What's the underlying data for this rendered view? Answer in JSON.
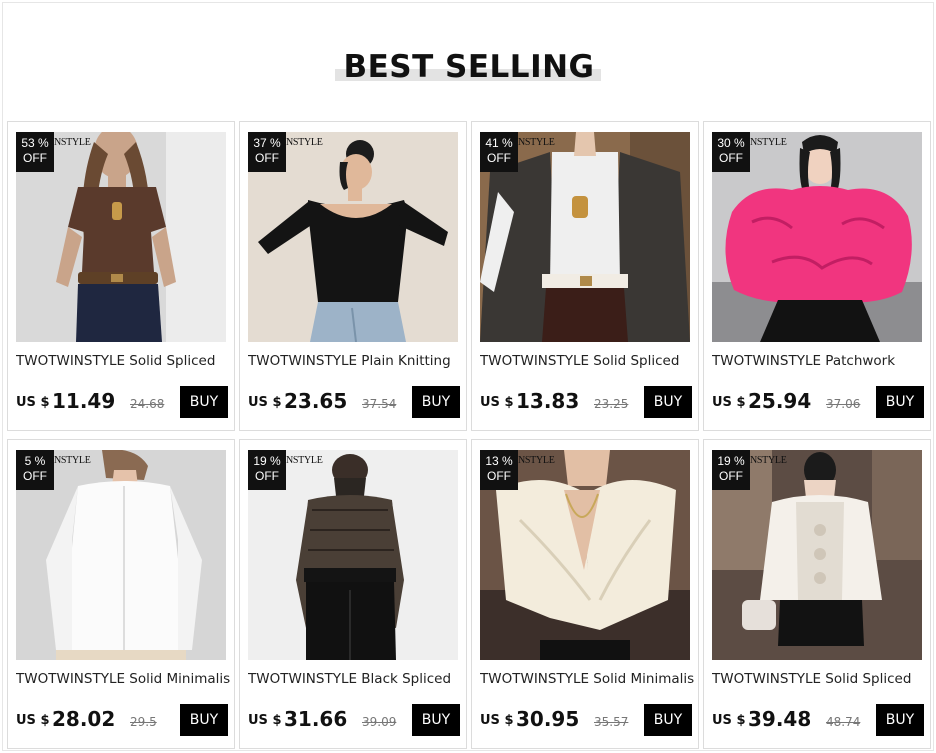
{
  "section": {
    "title": "BEST SELLING"
  },
  "products": [
    {
      "discount_pct": "53 %",
      "discount_off": "OFF",
      "brand_mark": "NSTYLE",
      "title": "TWOTWINSTYLE Solid Spliced",
      "currency": "US $",
      "price": "11.49",
      "old_price": "24.68",
      "buy_label": "BUY",
      "image": "brown-knit-top-photo"
    },
    {
      "discount_pct": "37 %",
      "discount_off": "OFF",
      "brand_mark": "NSTYLE",
      "title": "TWOTWINSTYLE Plain Knitting",
      "currency": "US $",
      "price": "23.65",
      "old_price": "37.54",
      "buy_label": "BUY",
      "image": "black-corset-knit-photo"
    },
    {
      "discount_pct": "41 %",
      "discount_off": "OFF",
      "brand_mark": "NSTYLE",
      "title": "TWOTWINSTYLE Solid Spliced",
      "currency": "US $",
      "price": "13.83",
      "old_price": "23.25",
      "buy_label": "BUY",
      "image": "white-knit-tweed-coat-photo"
    },
    {
      "discount_pct": "30 %",
      "discount_off": "OFF",
      "brand_mark": "NSTYLE",
      "title": "TWOTWINSTYLE Patchwork",
      "currency": "US $",
      "price": "25.94",
      "old_price": "37.06",
      "buy_label": "BUY",
      "image": "pink-ruffle-top-photo"
    },
    {
      "discount_pct": "5 %",
      "discount_off": "OFF",
      "brand_mark": "NSTYLE",
      "title": "TWOTWINSTYLE Solid Minimalist",
      "currency": "US $",
      "price": "28.02",
      "old_price": "29.5",
      "buy_label": "BUY",
      "image": "white-shirt-photo"
    },
    {
      "discount_pct": "19 %",
      "discount_off": "OFF",
      "brand_mark": "NSTYLE",
      "title": "TWOTWINSTYLE Black Spliced",
      "currency": "US $",
      "price": "31.66",
      "old_price": "39.09",
      "buy_label": "BUY",
      "image": "black-lace-top-photo"
    },
    {
      "discount_pct": "13 %",
      "discount_off": "OFF",
      "brand_mark": "NSTYLE",
      "title": "TWOTWINSTYLE Solid Minimalist",
      "currency": "US $",
      "price": "30.95",
      "old_price": "35.57",
      "buy_label": "BUY",
      "image": "cream-draped-top-photo"
    },
    {
      "discount_pct": "19 %",
      "discount_off": "OFF",
      "brand_mark": "NSTYLE",
      "title": "TWOTWINSTYLE Solid Spliced",
      "currency": "US $",
      "price": "39.48",
      "old_price": "48.74",
      "buy_label": "BUY",
      "image": "lace-ruffle-blouse-photo"
    }
  ],
  "colors": {
    "badge_bg": "#111111",
    "buy_bg": "#000000",
    "heading_bar": "#e3e3e3"
  }
}
